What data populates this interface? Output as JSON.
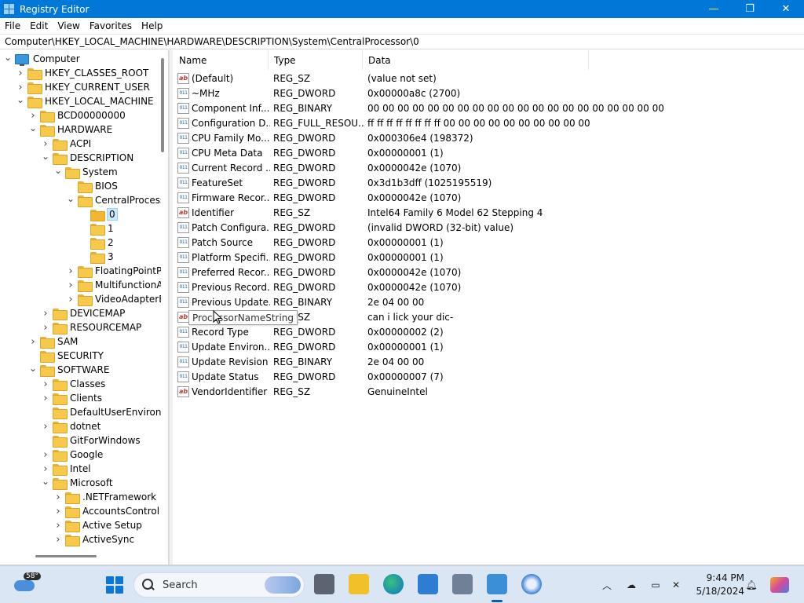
{
  "window": {
    "title": "Registry Editor",
    "minimize_glyph": "—",
    "maximize_glyph": "❐",
    "close_glyph": "✕"
  },
  "menu": [
    "File",
    "Edit",
    "View",
    "Favorites",
    "Help"
  ],
  "address": "Computer\\HKEY_LOCAL_MACHINE\\HARDWARE\\DESCRIPTION\\System\\CentralProcessor\\0",
  "tree": [
    {
      "label": "Computer",
      "level": 0,
      "expander": "open",
      "icon": "computer-icon",
      "name": "tree-item-computer"
    },
    {
      "label": "HKEY_CLASSES_ROOT",
      "level": 1,
      "expander": "closed",
      "name": "tree-item-hkey-classes-root"
    },
    {
      "label": "HKEY_CURRENT_USER",
      "level": 1,
      "expander": "closed",
      "name": "tree-item-hkey-current-user"
    },
    {
      "label": "HKEY_LOCAL_MACHINE",
      "level": 1,
      "expander": "open",
      "name": "tree-item-hkey-local-machine"
    },
    {
      "label": "BCD00000000",
      "level": 2,
      "expander": "closed",
      "name": "tree-item-bcd"
    },
    {
      "label": "HARDWARE",
      "level": 2,
      "expander": "open",
      "name": "tree-item-hardware"
    },
    {
      "label": "ACPI",
      "level": 3,
      "expander": "closed",
      "name": "tree-item-acpi"
    },
    {
      "label": "DESCRIPTION",
      "level": 3,
      "expander": "open",
      "name": "tree-item-description"
    },
    {
      "label": "System",
      "level": 4,
      "expander": "open",
      "name": "tree-item-system"
    },
    {
      "label": "BIOS",
      "level": 5,
      "expander": "none",
      "name": "tree-item-bios"
    },
    {
      "label": "CentralProcessor",
      "level": 5,
      "expander": "open",
      "name": "tree-item-centralprocessor"
    },
    {
      "label": "0",
      "level": 6,
      "expander": "none",
      "selected": true,
      "name": "tree-item-0"
    },
    {
      "label": "1",
      "level": 6,
      "expander": "none",
      "name": "tree-item-1"
    },
    {
      "label": "2",
      "level": 6,
      "expander": "none",
      "name": "tree-item-2"
    },
    {
      "label": "3",
      "level": 6,
      "expander": "none",
      "name": "tree-item-3"
    },
    {
      "label": "FloatingPointProcessor",
      "level": 5,
      "expander": "closed",
      "name": "tree-item-floatingpointprocessor"
    },
    {
      "label": "MultifunctionAdapter",
      "level": 5,
      "expander": "closed",
      "name": "tree-item-multifunctionadapter"
    },
    {
      "label": "VideoAdapterBusses",
      "level": 5,
      "expander": "closed",
      "name": "tree-item-videoadapterbusses"
    },
    {
      "label": "DEVICEMAP",
      "level": 3,
      "expander": "closed",
      "name": "tree-item-devicemap"
    },
    {
      "label": "RESOURCEMAP",
      "level": 3,
      "expander": "closed",
      "name": "tree-item-resourcemap"
    },
    {
      "label": "SAM",
      "level": 2,
      "expander": "closed",
      "name": "tree-item-sam"
    },
    {
      "label": "SECURITY",
      "level": 2,
      "expander": "none",
      "name": "tree-item-security"
    },
    {
      "label": "SOFTWARE",
      "level": 2,
      "expander": "open",
      "name": "tree-item-software"
    },
    {
      "label": "Classes",
      "level": 3,
      "expander": "closed",
      "name": "tree-item-classes"
    },
    {
      "label": "Clients",
      "level": 3,
      "expander": "closed",
      "name": "tree-item-clients"
    },
    {
      "label": "DefaultUserEnvironment",
      "level": 3,
      "expander": "none",
      "name": "tree-item-defaultuserenvironment"
    },
    {
      "label": "dotnet",
      "level": 3,
      "expander": "closed",
      "name": "tree-item-dotnet"
    },
    {
      "label": "GitForWindows",
      "level": 3,
      "expander": "none",
      "name": "tree-item-gitforwindows"
    },
    {
      "label": "Google",
      "level": 3,
      "expander": "closed",
      "name": "tree-item-google"
    },
    {
      "label": "Intel",
      "level": 3,
      "expander": "closed",
      "name": "tree-item-intel"
    },
    {
      "label": "Microsoft",
      "level": 3,
      "expander": "open",
      "name": "tree-item-microsoft"
    },
    {
      "label": ".NETFramework",
      "level": 4,
      "expander": "closed",
      "name": "tree-item-netframework"
    },
    {
      "label": "AccountsControl",
      "level": 4,
      "expander": "closed",
      "name": "tree-item-accountscontrol"
    },
    {
      "label": "Active Setup",
      "level": 4,
      "expander": "closed",
      "name": "tree-item-active-setup"
    },
    {
      "label": "ActiveSync",
      "level": 4,
      "expander": "closed",
      "name": "tree-item-activesync"
    }
  ],
  "columns": {
    "name": "Name",
    "type": "Type",
    "data": "Data"
  },
  "values": [
    {
      "name": "(Default)",
      "type": "REG_SZ",
      "data": "(value not set)",
      "icon": "sz"
    },
    {
      "name": "~MHz",
      "type": "REG_DWORD",
      "data": "0x00000a8c (2700)",
      "icon": "bin"
    },
    {
      "name": "Component Inf...",
      "type": "REG_BINARY",
      "data": "00 00 00 00 00 00 00 00 00 00 00 00 00 00 00 00 00 00 00 00",
      "icon": "bin"
    },
    {
      "name": "Configuration D...",
      "type": "REG_FULL_RESOU...",
      "data": "ff ff ff ff ff ff ff ff 00 00 00 00 00 00 00 00 00 00",
      "icon": "bin"
    },
    {
      "name": "CPU Family Mo...",
      "type": "REG_DWORD",
      "data": "0x000306e4 (198372)",
      "icon": "bin"
    },
    {
      "name": "CPU Meta Data",
      "type": "REG_DWORD",
      "data": "0x00000001 (1)",
      "icon": "bin"
    },
    {
      "name": "Current Record ...",
      "type": "REG_DWORD",
      "data": "0x0000042e (1070)",
      "icon": "bin"
    },
    {
      "name": "FeatureSet",
      "type": "REG_DWORD",
      "data": "0x3d1b3dff (1025195519)",
      "icon": "bin"
    },
    {
      "name": "Firmware Recor...",
      "type": "REG_DWORD",
      "data": "0x0000042e (1070)",
      "icon": "bin"
    },
    {
      "name": "Identifier",
      "type": "REG_SZ",
      "data": "Intel64 Family 6 Model 62 Stepping 4",
      "icon": "sz"
    },
    {
      "name": "Patch Configura...",
      "type": "REG_DWORD",
      "data": "(invalid DWORD (32-bit) value)",
      "icon": "bin"
    },
    {
      "name": "Patch Source",
      "type": "REG_DWORD",
      "data": "0x00000001 (1)",
      "icon": "bin"
    },
    {
      "name": "Platform Specifi...",
      "type": "REG_DWORD",
      "data": "0x00000001 (1)",
      "icon": "bin"
    },
    {
      "name": "Preferred Recor...",
      "type": "REG_DWORD",
      "data": "0x0000042e (1070)",
      "icon": "bin"
    },
    {
      "name": "Previous Record...",
      "type": "REG_DWORD",
      "data": "0x0000042e (1070)",
      "icon": "bin"
    },
    {
      "name": "Previous Update...",
      "type": "REG_BINARY",
      "data": "2e 04 00 00",
      "icon": "bin"
    },
    {
      "name": "ProcessorNameString",
      "type": "REG_SZ",
      "data": "can i lick your dic-",
      "icon": "sz"
    },
    {
      "name": "Record Type",
      "type": "REG_DWORD",
      "data": "0x00000002 (2)",
      "icon": "bin"
    },
    {
      "name": "Update Environ...",
      "type": "REG_DWORD",
      "data": "0x00000001 (1)",
      "icon": "bin"
    },
    {
      "name": "Update Revision",
      "type": "REG_BINARY",
      "data": "2e 04 00 00",
      "icon": "bin"
    },
    {
      "name": "Update Status",
      "type": "REG_DWORD",
      "data": "0x00000007 (7)",
      "icon": "bin"
    },
    {
      "name": "VendorIdentifier",
      "type": "REG_SZ",
      "data": "GenuineIntel",
      "icon": "sz"
    }
  ],
  "tooltip": "ProcessorNameString",
  "taskbar": {
    "weather_temp": "58°",
    "search_label": "Search",
    "time": "9:44 PM",
    "date": "5/18/2024",
    "accent": "#0078d7"
  }
}
